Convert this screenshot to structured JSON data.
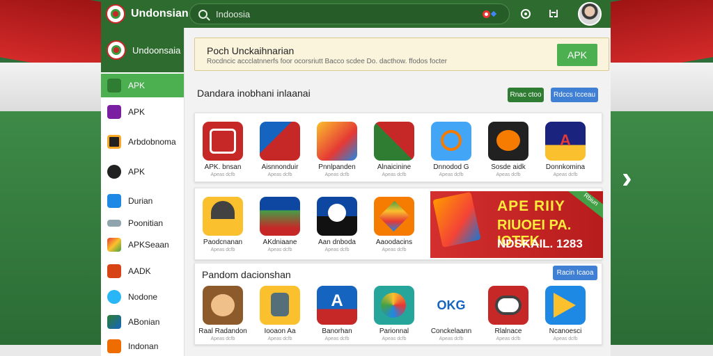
{
  "header": {
    "brand": "Undonsian",
    "search_placeholder": "Indoosia"
  },
  "sidebar": {
    "title": "Undoonsaia",
    "items": [
      {
        "label": "APK",
        "color": "#43a047"
      },
      {
        "label": "APK",
        "color": "#7b1fa2"
      },
      {
        "label": "Arbdobnoma",
        "color": "#f9a825"
      },
      {
        "label": "APK",
        "color": "#212121"
      },
      {
        "label": "Durian",
        "color": "#1e88e5"
      },
      {
        "label": "Poonitian",
        "color": "#78909c"
      },
      {
        "label": "APKSeaan",
        "color": "#e53935"
      },
      {
        "label": "AADK",
        "color": "#d84315"
      },
      {
        "label": "Nodone",
        "color": "#29b6f6"
      },
      {
        "label": "ABonian",
        "color": "#2e7d32"
      },
      {
        "label": "Indonan",
        "color": "#ef6c00"
      }
    ]
  },
  "promo": {
    "title": "Poch Unckaihnarian",
    "subtitle": "Rocdncic accclatnnerfs foor ocorsriutt Bacco scdee Do. dacthow. ffodos focter",
    "button": "APK"
  },
  "section1": {
    "title": "Dandara inobhani inlaanai",
    "chip_green": "Rnac ctoo",
    "chip_blue": "Rdccs Icceau"
  },
  "row1": [
    {
      "name": "APK. bnsan",
      "sub": "Apeas dcfb",
      "color": "#c62828"
    },
    {
      "name": "Aisnnonduir",
      "sub": "Apeas dcfb",
      "color": "#1565c0"
    },
    {
      "name": "Pnnlpanden",
      "sub": "Apeas dcfb",
      "color": "#f9a825"
    },
    {
      "name": "Alnaicinine",
      "sub": "Apeas dcfb",
      "color": "#2e7d32"
    },
    {
      "name": "Dnnodod G",
      "sub": "Apeas dcfb",
      "color": "#1e88e5"
    },
    {
      "name": "Sosde aidk",
      "sub": "Apeas dcfb",
      "color": "#212121"
    },
    {
      "name": "Donnkomina",
      "sub": "Apeas dcfb",
      "color": "#1a237e"
    }
  ],
  "row2": [
    {
      "name": "Paodcnanan",
      "sub": "Apeas dcfb",
      "color": "#f9a825"
    },
    {
      "name": "AKdniaane",
      "sub": "Apeas dcfb",
      "color": "#c62828"
    },
    {
      "name": "Aan dnboda",
      "sub": "Apeas dcfb",
      "color": "#0d47a1"
    },
    {
      "name": "Aaoodacins",
      "sub": "Apeas dcfb",
      "color": "#f57c00"
    }
  ],
  "banner": {
    "line1": "APE RIIY",
    "line2": "RIUOEI PA. IOTEK",
    "line3": "NDSKAIL.   1283",
    "tag": "Rbiun"
  },
  "section2": {
    "title": "Pandom dacionshan",
    "chip_blue": "Racin Icaoa"
  },
  "row3": [
    {
      "name": "Raal Radandon",
      "sub": "Apeas dcfb",
      "color": "#8d5a2b"
    },
    {
      "name": "Iooaon Aa",
      "sub": "Apeas dcfb",
      "color": "#f9a825"
    },
    {
      "name": "Banorhan",
      "sub": "Apeas dcfb",
      "color": "#1565c0"
    },
    {
      "name": "Parionnal",
      "sub": "Apeas dcfb",
      "color": "#26a69a"
    },
    {
      "name": "Conckelaann",
      "sub": "Apeas dcfb",
      "color": "#ffffff"
    },
    {
      "name": "Rlalnace",
      "sub": "Apeas dcfb",
      "color": "#c62828"
    },
    {
      "name": "Ncanoesci",
      "sub": "Apeas dcfb",
      "color": "#1e88e5"
    }
  ]
}
